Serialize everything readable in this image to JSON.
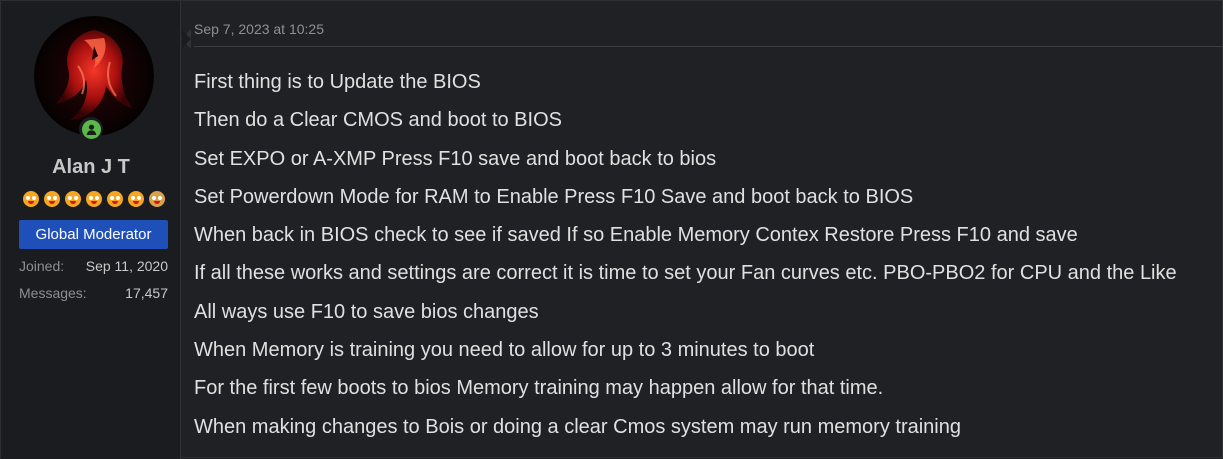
{
  "user": {
    "name": "Alan J T",
    "title": "Global Moderator",
    "trophy_colors": [
      "#f5a623",
      "#f5a623",
      "#f5a623",
      "#f5a623",
      "#f5a623",
      "#f5a623",
      "#d9a14a"
    ],
    "stats": [
      {
        "label": "Joined:",
        "value": "Sep 11, 2020"
      },
      {
        "label": "Messages:",
        "value": "17,457"
      }
    ],
    "online": true,
    "avatar_icon": "red-dragon-avatar"
  },
  "post": {
    "timestamp": "Sep 7, 2023 at 10:25",
    "lines": [
      "First thing is to Update the BIOS",
      "Then do a Clear CMOS and boot to BIOS",
      "Set EXPO or A-XMP Press F10 save and boot back to bios",
      "Set Powerdown Mode for RAM to Enable Press F10 Save and boot back to BIOS",
      "When back in BIOS check to see if saved If so Enable Memory Contex Restore Press F10 and save",
      "If all these works and settings are correct it is time to set your Fan curves etc. PBO-PBO2 for CPU and the Like",
      "All ways use F10 to save bios changes",
      "When Memory is training you need to allow for up to 3 minutes to boot",
      "For the first few boots to bios Memory training may happen allow for that time.",
      "When making changes to Bois or doing a clear Cmos system may run memory training"
    ]
  },
  "colors": {
    "banner": "#1f4fb8",
    "online": "#5bb749",
    "background": "#202124"
  }
}
